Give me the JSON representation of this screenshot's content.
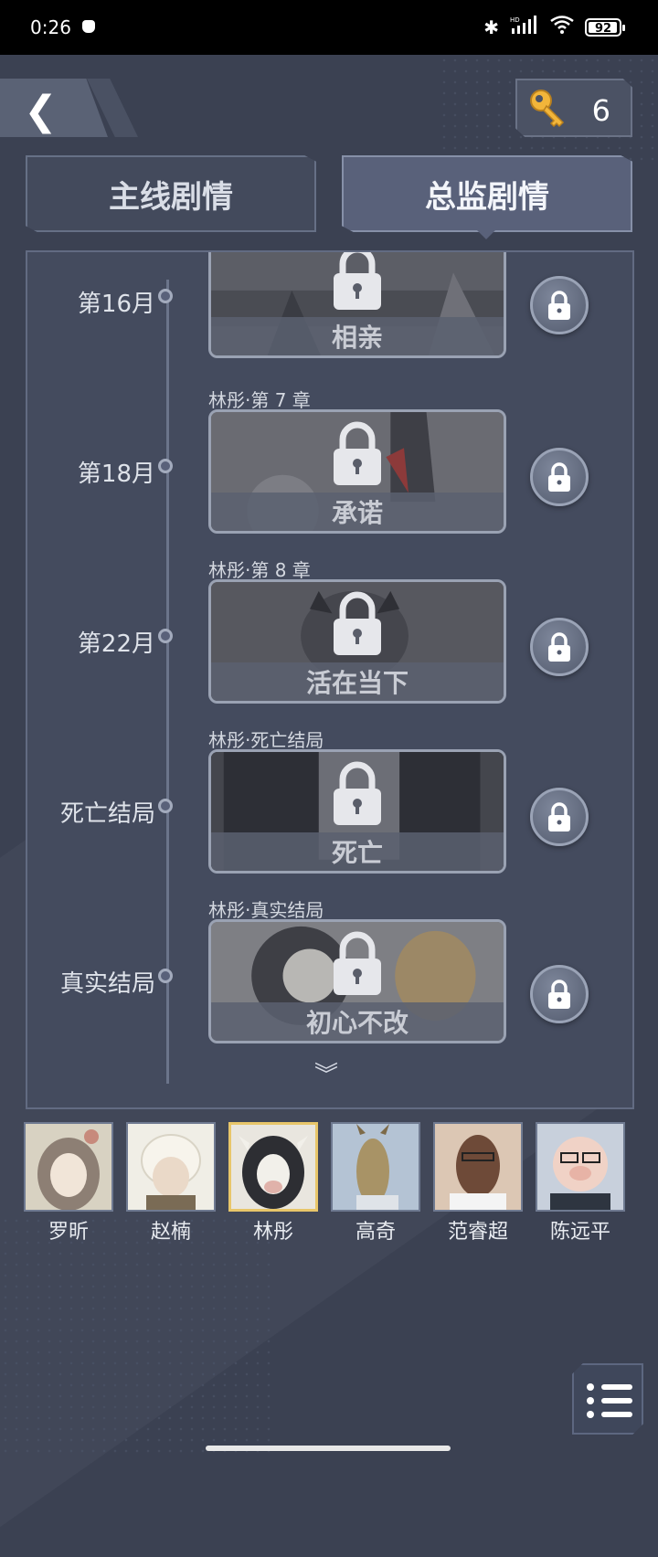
{
  "status_bar": {
    "time": "0:26",
    "battery": "92",
    "icons": [
      "bluetooth-icon",
      "hd-signal-icon",
      "wifi-icon",
      "battery-icon"
    ]
  },
  "header": {
    "key_count": "6"
  },
  "tabs": [
    {
      "label": "主线剧情",
      "active": false
    },
    {
      "label": "总监剧情",
      "active": true
    }
  ],
  "timeline": [
    {
      "month": "第16月",
      "caption": "",
      "title": "相亲",
      "locked": true
    },
    {
      "month": "第18月",
      "caption": "林彤·第 7 章",
      "title": "承诺",
      "locked": true
    },
    {
      "month": "第22月",
      "caption": "林彤·第 8 章",
      "title": "活在当下",
      "locked": true
    },
    {
      "month": "死亡结局",
      "caption": "林彤·死亡结局",
      "title": "死亡",
      "locked": true
    },
    {
      "month": "真实结局",
      "caption": "林彤·真实结局",
      "title": "初心不改",
      "locked": true
    }
  ],
  "characters": [
    {
      "name": "罗昕",
      "selected": false
    },
    {
      "name": "赵楠",
      "selected": false
    },
    {
      "name": "林彤",
      "selected": true
    },
    {
      "name": "高奇",
      "selected": false
    },
    {
      "name": "范睿超",
      "selected": false
    },
    {
      "name": "陈远平",
      "selected": false
    }
  ],
  "colors": {
    "background": "#3b4152",
    "panel": "#444b5e",
    "selected_border": "#e8c66a",
    "key_gold": "#f2b53a"
  }
}
